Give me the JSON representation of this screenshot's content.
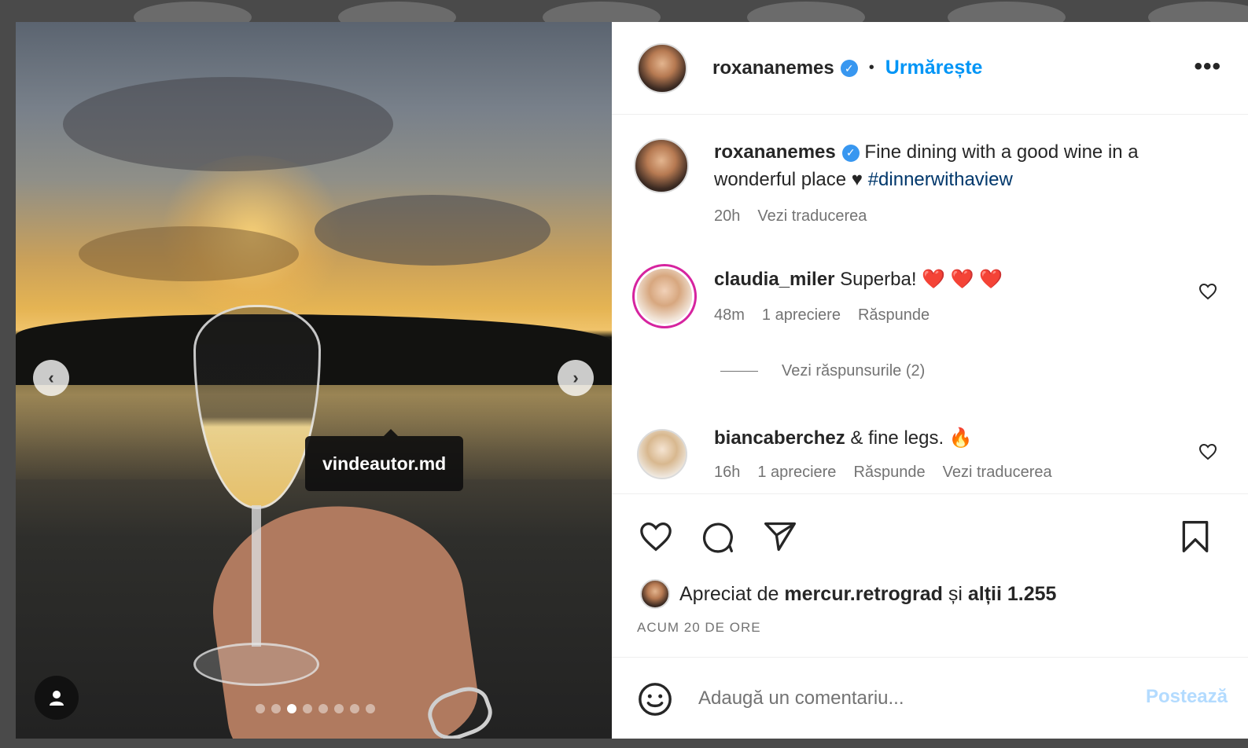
{
  "post": {
    "username": "roxananemes",
    "follow_label": "Urmărește",
    "separator": "•",
    "more_label": "•••",
    "tag_label": "vindeautor.md",
    "carousel": {
      "count": 8,
      "active": 2
    }
  },
  "caption": {
    "username": "roxananemes",
    "text": "Fine dining with a good wine in a wonderful place",
    "heart": "♥",
    "hashtag": "#dinnerwithaview",
    "time": "20h",
    "translate": "Vezi traducerea"
  },
  "comments": [
    {
      "username": "claudia_miler",
      "text": "Superba!",
      "emoji": "❤️ ❤️ ❤️",
      "time": "48m",
      "likes": "1 apreciere",
      "reply": "Răspunde"
    },
    {
      "username": "biancaberchez",
      "text": "& fine legs.",
      "emoji": "🔥",
      "time": "16h",
      "likes": "1 apreciere",
      "reply": "Răspunde",
      "translate": "Vezi traducerea"
    }
  ],
  "replies_label": "Vezi răspunsurile (2)",
  "likes": {
    "prefix": "Apreciat de",
    "user": "mercur.retrograd",
    "middle": "și",
    "others": "alții 1.255"
  },
  "posted_ago": "ACUM 20 DE ORE",
  "add_comment": {
    "placeholder": "Adaugă un comentariu...",
    "post_label": "Postează"
  },
  "colors": {
    "accent": "#0095f6",
    "verified": "#3897f0",
    "muted": "#737373",
    "post_disabled": "#b3dbff"
  }
}
